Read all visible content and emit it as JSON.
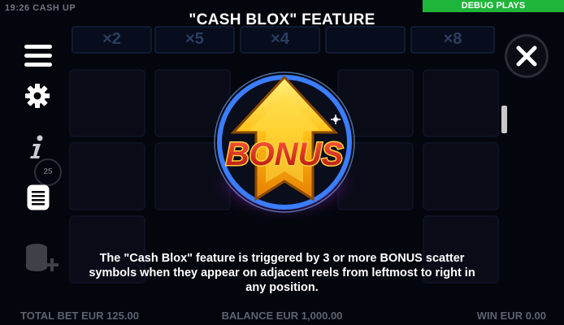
{
  "status": {
    "time_app": "19:26  CASH UP"
  },
  "debug": {
    "label": "DEBUG PLAYS"
  },
  "title": "\"CASH BLOX\" FEATURE",
  "background": {
    "multipliers": [
      "×2",
      "×5",
      "×4",
      "",
      "×8"
    ],
    "level_badge": "25"
  },
  "symbol": {
    "text": "BONUS"
  },
  "description": "The \"Cash Blox\" feature is triggered by 3 or more BONUS scatter symbols when they appear on adjacent reels from leftmost to right in any position.",
  "footer": {
    "total_bet": "TOTAL BET EUR 125.00",
    "balance": "BALANCE EUR 1,000.00",
    "win": "WIN EUR 0.00"
  },
  "icons": {
    "menu": "hamburger-menu-icon",
    "settings": "gear-icon",
    "info": "info-icon",
    "paytable": "paytable-list-icon",
    "coins": "coin-stack-icon",
    "close": "close-icon"
  },
  "colors": {
    "debug_bg": "#1fb43a",
    "bonus_gold": "#ffc21a",
    "bonus_red": "#d8231b",
    "ring_blue": "#3b7dff",
    "glow_pink": "#ff3ad0"
  }
}
